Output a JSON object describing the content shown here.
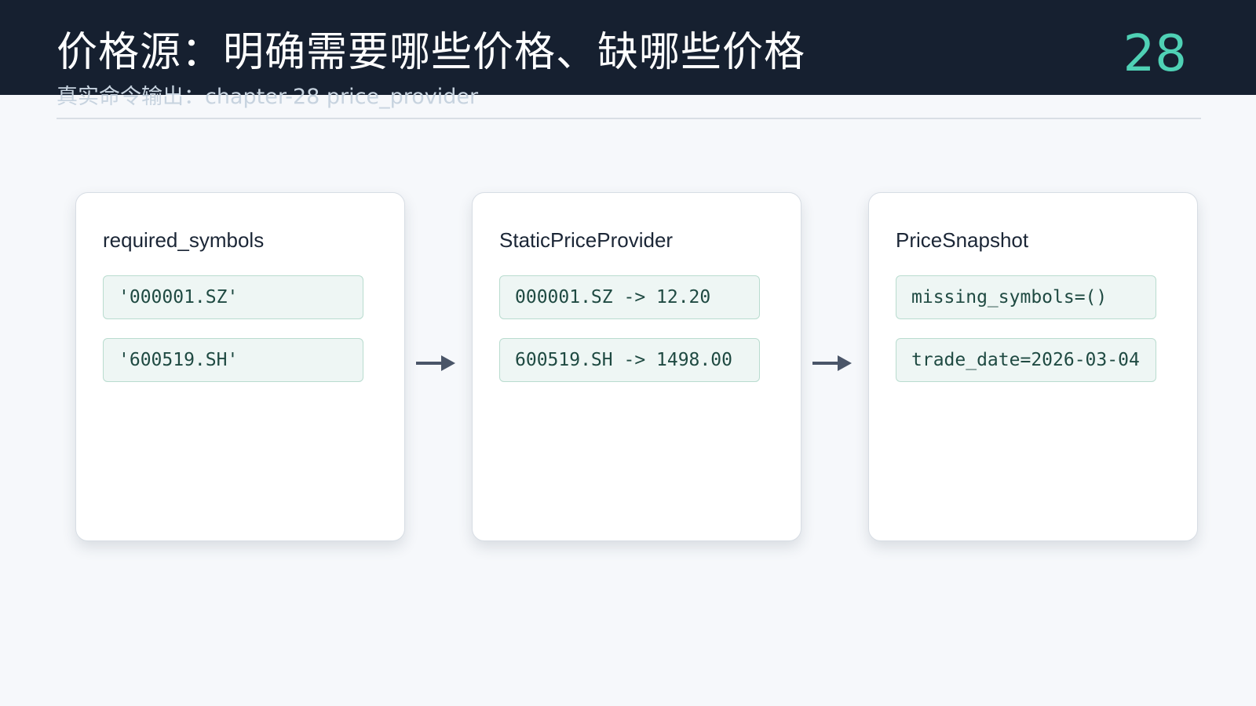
{
  "header": {
    "title": "价格源：明确需要哪些价格、缺哪些价格",
    "page_number": "28",
    "subtitle": "真实命令输出：chapter-28 price_provider"
  },
  "cards": [
    {
      "title": "required_symbols",
      "items": [
        "'000001.SZ'",
        "'600519.SH'"
      ]
    },
    {
      "title": "StaticPriceProvider",
      "items": [
        "000001.SZ -> 12.20",
        "600519.SH -> 1498.00"
      ]
    },
    {
      "title": "PriceSnapshot",
      "items": [
        "missing_symbols=()",
        "trade_date=2026-03-04"
      ]
    }
  ],
  "colors": {
    "header_bg": "#162030",
    "accent": "#4fd1b5",
    "pill_bg": "#eef6f4",
    "pill_border": "#b9dccf",
    "arrow": "#4a5568"
  }
}
